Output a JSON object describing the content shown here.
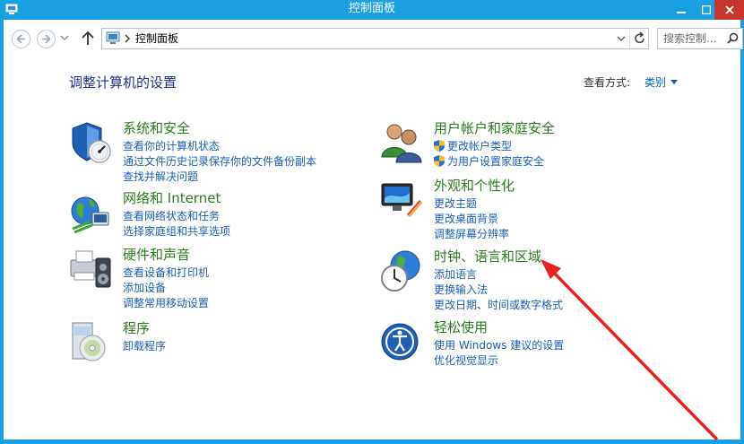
{
  "window": {
    "title": "控制面板"
  },
  "address": {
    "path": "控制面板",
    "search_placeholder": "搜索控制..."
  },
  "page": {
    "heading": "调整计算机的设置",
    "view_label": "查看方式:",
    "view_value": "类别"
  },
  "categories_left": [
    {
      "title": "系统和安全",
      "icon": "security-shield-icon",
      "links": [
        "查看你的计算机状态",
        "通过文件历史记录保存你的文件备份副本",
        "查找并解决问题"
      ]
    },
    {
      "title": "网络和 Internet",
      "icon": "network-globe-icon",
      "links": [
        "查看网络状态和任务",
        "选择家庭组和共享选项"
      ]
    },
    {
      "title": "硬件和声音",
      "icon": "printer-hardware-icon",
      "links": [
        "查看设备和打印机",
        "添加设备",
        "调整常用移动设置"
      ]
    },
    {
      "title": "程序",
      "icon": "programs-box-icon",
      "links": [
        "卸载程序"
      ]
    }
  ],
  "categories_right": [
    {
      "title": "用户帐户和家庭安全",
      "icon": "users-icon",
      "links": [
        "更改帐户类型",
        "为用户设置家庭安全"
      ]
    },
    {
      "title": "外观和个性化",
      "icon": "display-palette-icon",
      "links": [
        "更改主题",
        "更改桌面背景",
        "调整屏幕分辨率"
      ]
    },
    {
      "title": "时钟、语言和区域",
      "icon": "clock-globe-icon",
      "links": [
        "添加语言",
        "更换输入法",
        "更改日期、时间或数字格式"
      ]
    },
    {
      "title": "轻松使用",
      "icon": "ease-of-access-icon",
      "links": [
        "使用 Windows 建议的设置",
        "优化视觉显示"
      ]
    }
  ],
  "colors": {
    "titlebar": "#1ba1e2",
    "category_title": "#2b7d1e",
    "link": "#1a5fb4",
    "heading": "#1e3287",
    "annotation_arrow": "#e8231f"
  }
}
